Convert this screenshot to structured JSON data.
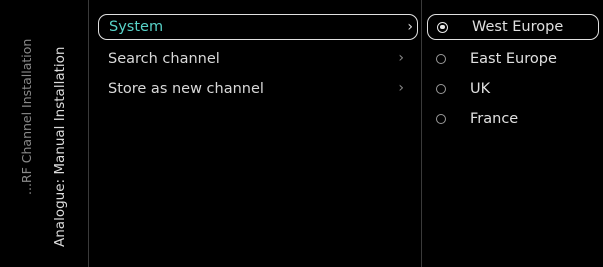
{
  "breadcrumbs": {
    "parent": "...RF Channel Installation",
    "current": "Analogue: Manual Installation"
  },
  "menu": {
    "items": [
      {
        "label": "System",
        "chevron": "›",
        "selected": true
      },
      {
        "label": "Search channel",
        "chevron": "›",
        "selected": false
      },
      {
        "label": "Store as new channel",
        "chevron": "›",
        "selected": false
      }
    ]
  },
  "options": {
    "items": [
      {
        "label": "West Europe",
        "checked": true
      },
      {
        "label": "East Europe",
        "checked": false
      },
      {
        "label": "UK",
        "checked": false
      },
      {
        "label": "France",
        "checked": false
      }
    ]
  },
  "colors": {
    "background": "#000000",
    "selected_text": "#58d3c9",
    "text": "#e0e0e0",
    "muted": "#8a8a8a",
    "divider": "#3a3a3a"
  }
}
